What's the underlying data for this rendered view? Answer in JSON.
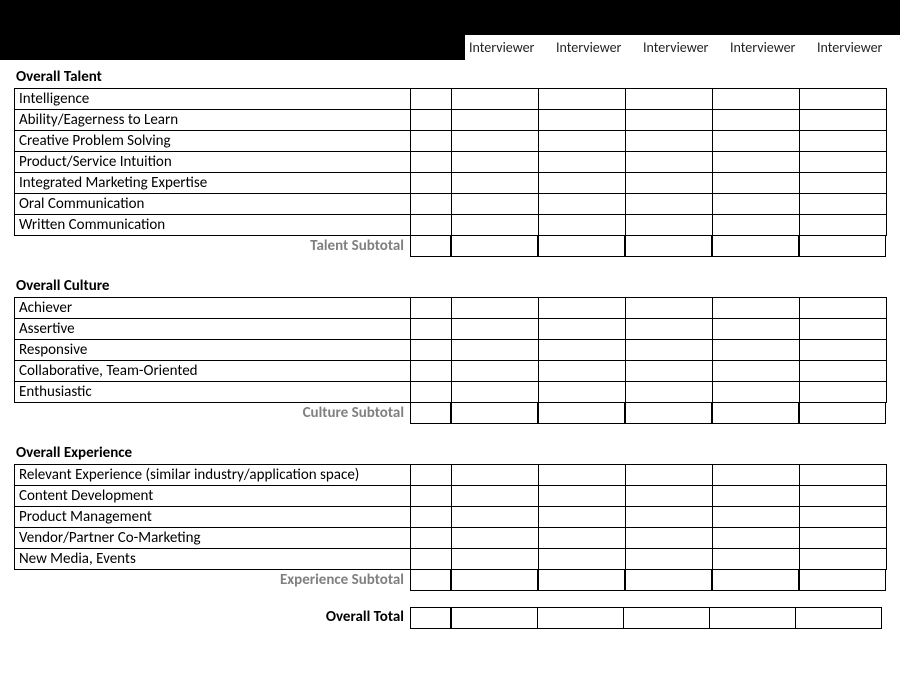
{
  "columns": [
    "Interviewer",
    "Interviewer",
    "Interviewer",
    "Interviewer",
    "Interviewer"
  ],
  "sections": {
    "talent": {
      "title": "Overall Talent",
      "rows": [
        "Intelligence",
        "Ability/Eagerness to Learn",
        "Creative Problem Solving",
        "Product/Service Intuition",
        "Integrated Marketing Expertise",
        "Oral Communication",
        "Written Communication"
      ],
      "subtotal_label": "Talent Subtotal"
    },
    "culture": {
      "title": "Overall Culture",
      "rows": [
        "Achiever",
        "Assertive",
        "Responsive",
        "Collaborative, Team-Oriented",
        "Enthusiastic"
      ],
      "subtotal_label": "Culture Subtotal"
    },
    "experience": {
      "title": "Overall Experience",
      "rows": [
        "Relevant Experience (similar industry/application space)",
        "Content Development",
        "Product Management",
        "Vendor/Partner Co-Marketing",
        "New Media, Events"
      ],
      "subtotal_label": "Experience Subtotal"
    }
  },
  "overall_total_label": "Overall Total"
}
